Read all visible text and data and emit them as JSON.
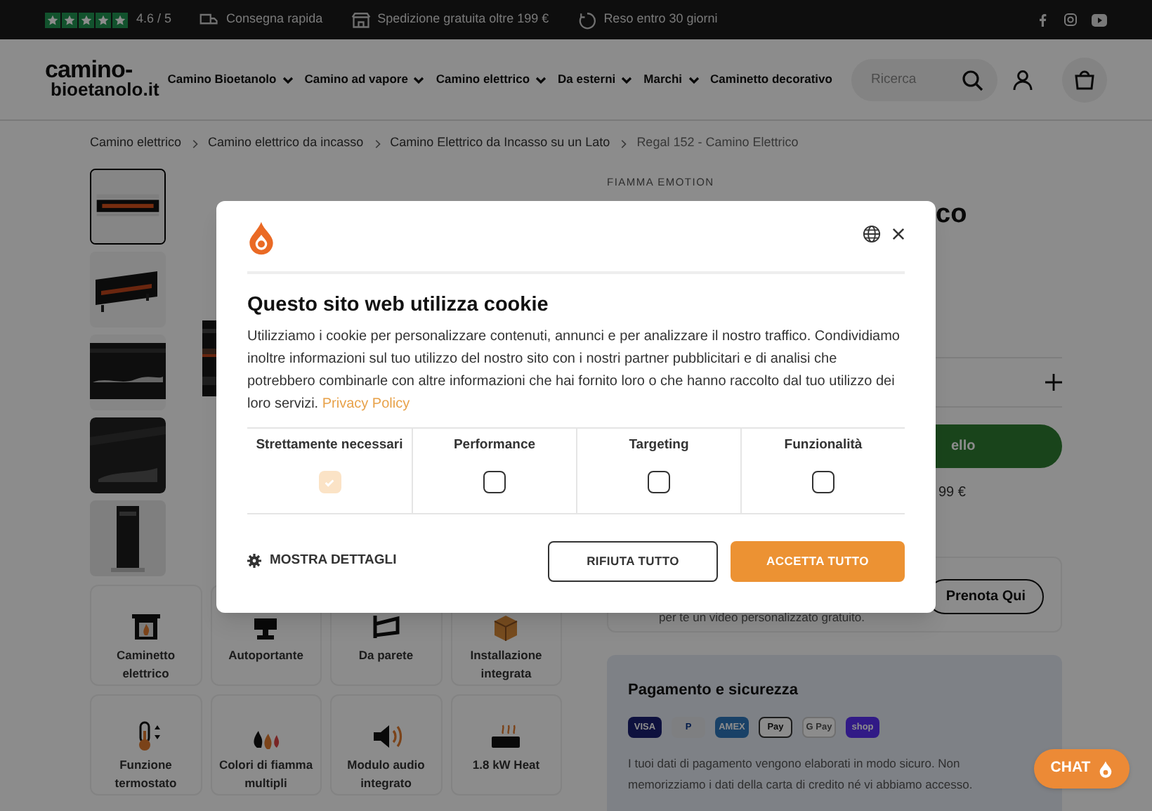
{
  "top_bar": {
    "rating": {
      "stars": 5,
      "score": "4.6 / 5"
    },
    "perks": [
      {
        "kind": "truck",
        "label": "Consegna rapida"
      },
      {
        "kind": "store",
        "label": "Spedizione gratuita oltre 199 €"
      },
      {
        "kind": "return",
        "label": "Reso entro 30 giorni"
      }
    ]
  },
  "header": {
    "logo": [
      "camino-",
      "bioetanolo.it"
    ],
    "nav": [
      {
        "label": "Camino Bioetanolo",
        "dropdown": true
      },
      {
        "label": "Camino ad vapore",
        "dropdown": true
      },
      {
        "label": "Camino elettrico",
        "dropdown": true
      },
      {
        "label": "Da esterni",
        "dropdown": true
      },
      {
        "label": "Marchi",
        "dropdown": true
      },
      {
        "label": "Caminetto decorativo",
        "dropdown": false
      }
    ],
    "search": {
      "placeholder": "Ricerca"
    }
  },
  "breadcrumb": [
    "Camino elettrico",
    "Camino elettrico da incasso",
    "Camino Elettrico da Incasso su un Lato",
    "Regal 152 - Camino Elettrico"
  ],
  "gallery": {
    "thumbnails": [
      {
        "kind": "picture",
        "selected": true
      },
      {
        "kind": "picture",
        "selected": false
      },
      {
        "kind": "picture",
        "selected": false
      },
      {
        "kind": "picture",
        "selected": false
      },
      {
        "kind": "picture",
        "selected": false
      }
    ]
  },
  "features": [
    {
      "kind": "fireplace",
      "label": "Caminetto elettrico"
    },
    {
      "kind": "stand",
      "label": "Autoportante"
    },
    {
      "kind": "wall",
      "label": "Da parete"
    },
    {
      "kind": "box",
      "label": "Installazione integrata"
    },
    {
      "kind": "thermo",
      "label": "Funzione termostato"
    },
    {
      "kind": "flames",
      "label": "Colori di fiamma multipli"
    },
    {
      "kind": "speaker",
      "label": "Modulo audio integrato"
    },
    {
      "kind": "heat",
      "label": "1.8 kW Heat"
    }
  ],
  "product": {
    "brand": "FIAMMA EMOTION",
    "title": "co",
    "cart_button": "ello",
    "price_note": "99 €",
    "video_text": "per te un video personalizzato gratuito.",
    "video_button": "Prenota Qui",
    "payment": {
      "title": "Pagamento e sicurezza",
      "methods": [
        {
          "label": "VISA",
          "kind": "visa"
        },
        {
          "label": "P",
          "kind": "paypal"
        },
        {
          "label": "AMEX",
          "kind": "amex"
        },
        {
          "label": "Pay",
          "kind": "apple"
        },
        {
          "label": "G Pay",
          "kind": "google"
        },
        {
          "label": "shop",
          "kind": "shop"
        }
      ],
      "text": "I tuoi dati di pagamento vengono elaborati in modo sicuro. Non memorizziamo i dati della carta di credito né vi abbiamo accesso."
    }
  },
  "cookie_dialog": {
    "title": "Questo sito web utilizza cookie",
    "text": "Utilizziamo i cookie per personalizzare contenuti, annunci e per analizzare il nostro traffico. Condividiamo inoltre informazioni sul tuo utilizzo del nostro sito con i nostri partner pubblicitari e di analisi che potrebbero combinarle con altre informazioni che hai fornito loro o che hanno raccolto dal tuo utilizzo dei loro servizi.",
    "link": "Privacy Policy",
    "categories": [
      {
        "label": "Strettamente necessari",
        "checked": true,
        "disabled": true
      },
      {
        "label": "Performance",
        "checked": false,
        "disabled": false
      },
      {
        "label": "Targeting",
        "checked": false,
        "disabled": false
      },
      {
        "label": "Funzionalità",
        "checked": false,
        "disabled": false
      }
    ],
    "details": "MOSTRA DETTAGLI",
    "reject": "RIFIUTA TUTTO",
    "accept": "ACCETTA TUTTO"
  },
  "chat": {
    "label": "CHAT"
  }
}
